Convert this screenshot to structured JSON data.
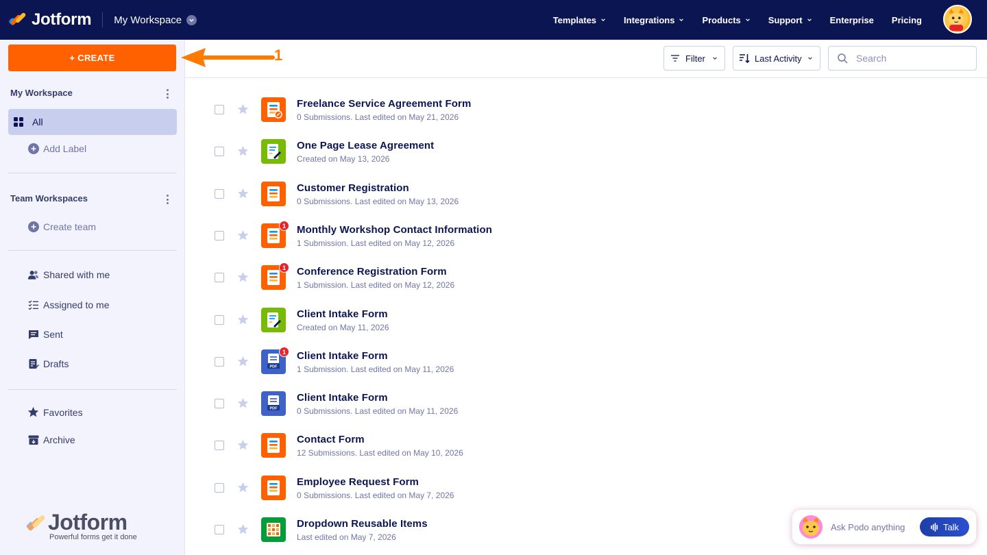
{
  "brand": {
    "name": "Jotform",
    "tagline": "Powerful forms get it done"
  },
  "topbar": {
    "workspace": "My Workspace",
    "nav": [
      "Templates",
      "Integrations",
      "Products",
      "Support",
      "Enterprise",
      "Pricing"
    ]
  },
  "sidebar": {
    "create_label": "+ CREATE",
    "my_workspace": "My Workspace",
    "all_label": "All",
    "add_label": "Add Label",
    "team_workspaces": "Team Workspaces",
    "create_team": "Create team",
    "shared": "Shared with me",
    "assigned": "Assigned to me",
    "sent": "Sent",
    "drafts": "Drafts",
    "favorites": "Favorites",
    "archive": "Archive"
  },
  "annotation": {
    "step": "1"
  },
  "toolbar": {
    "filter": "Filter",
    "sort": "Last Activity",
    "search_placeholder": "Search"
  },
  "forms": [
    {
      "title": "Freelance Service Agreement Form",
      "meta": "0 Submissions. Last edited on May 21, 2026",
      "kind": "form-edit",
      "badge": ""
    },
    {
      "title": "One Page Lease Agreement",
      "meta": "Created on May 13, 2026",
      "kind": "sign",
      "badge": ""
    },
    {
      "title": "Customer Registration",
      "meta": "0 Submissions. Last edited on May 13, 2026",
      "kind": "form",
      "badge": ""
    },
    {
      "title": "Monthly Workshop Contact Information",
      "meta": "1 Submission. Last edited on May 12, 2026",
      "kind": "form",
      "badge": "1"
    },
    {
      "title": "Conference Registration Form",
      "meta": "1 Submission. Last edited on May 12, 2026",
      "kind": "form",
      "badge": "1"
    },
    {
      "title": "Client Intake Form",
      "meta": "Created on May 11, 2026",
      "kind": "sign",
      "badge": ""
    },
    {
      "title": "Client Intake Form",
      "meta": "1 Submission. Last edited on May 11, 2026",
      "kind": "pdf",
      "badge": "1"
    },
    {
      "title": "Client Intake Form",
      "meta": "0 Submissions. Last edited on May 11, 2026",
      "kind": "pdf",
      "badge": ""
    },
    {
      "title": "Contact Form",
      "meta": "12 Submissions. Last edited on May 10, 2026",
      "kind": "form",
      "badge": ""
    },
    {
      "title": "Employee Request Form",
      "meta": "0 Submissions. Last edited on May 7, 2026",
      "kind": "form",
      "badge": ""
    },
    {
      "title": "Dropdown Reusable Items",
      "meta": "Last edited on May 7, 2026",
      "kind": "table",
      "badge": ""
    }
  ],
  "podo": {
    "prompt": "Ask Podo anything",
    "talk": "Talk"
  },
  "colors": {
    "navy": "#0a1551",
    "orange": "#ff6100",
    "green": "#78bb07",
    "pdf_blue": "#3e62c8",
    "sidebar": "#f3f3fe",
    "selected": "#c8ceed"
  },
  "icons": [
    "search-icon",
    "filter-icon",
    "sort-icon",
    "star-icon",
    "chevron-down-icon",
    "kebab-icon",
    "grid-icon",
    "plus-circle-icon",
    "users-icon",
    "checklist-icon",
    "message-icon",
    "draft-icon",
    "archive-icon",
    "mic-icon"
  ]
}
